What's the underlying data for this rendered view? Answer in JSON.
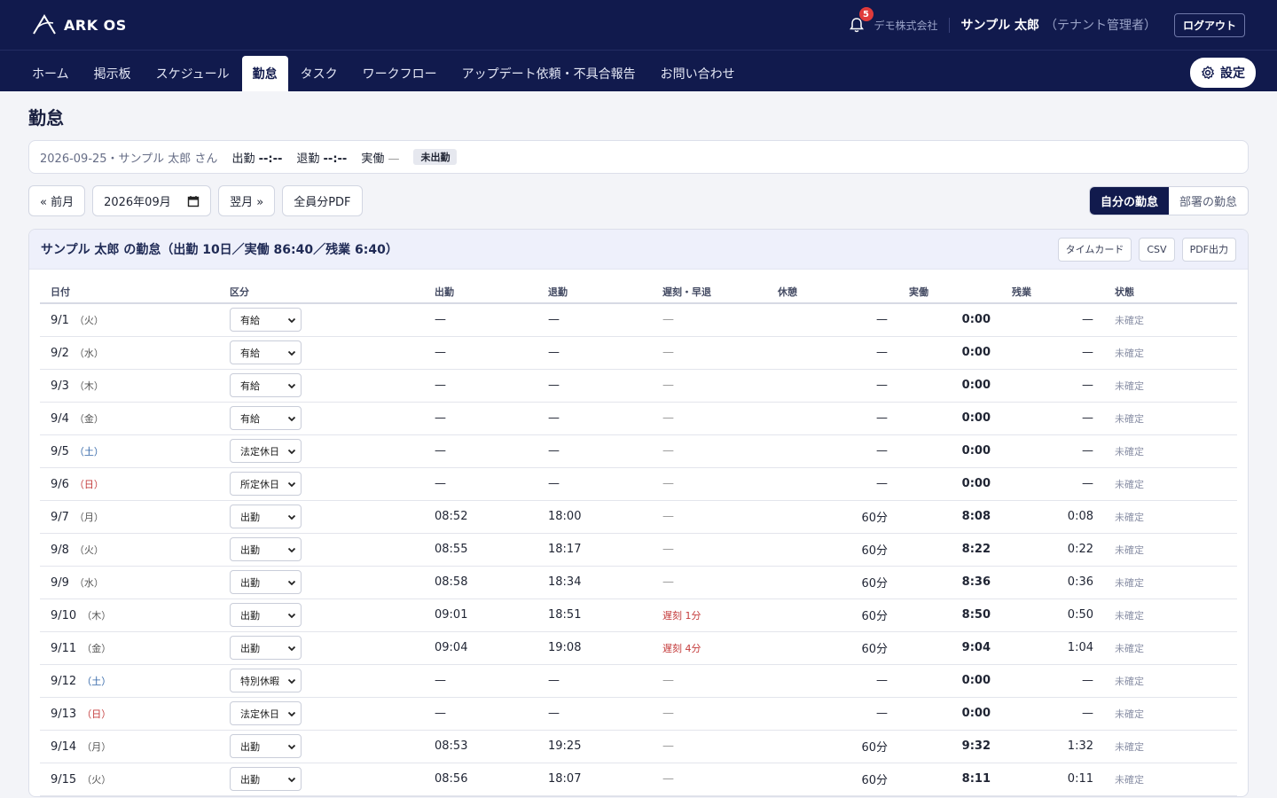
{
  "app": {
    "name": "ARK OS"
  },
  "header": {
    "notification_count": "5",
    "company": "デモ株式会社",
    "user_name": "サンプル 太郎",
    "user_role": "（テナント管理者）",
    "logout_label": "ログアウト"
  },
  "nav": {
    "items": [
      "ホーム",
      "掲示板",
      "スケジュール",
      "勤怠",
      "タスク",
      "ワークフロー",
      "アップデート依頼・不具合報告",
      "お問い合わせ"
    ],
    "active_index": 3,
    "settings_label": "設定"
  },
  "page": {
    "title": "勤怠"
  },
  "status": {
    "date_user": "2026-09-25・サンプル 太郎 さん",
    "clock_in_label": "出勤",
    "clock_in_value": "--:--",
    "clock_out_label": "退勤",
    "clock_out_value": "--:--",
    "actual_label": "実働",
    "actual_value": "—",
    "badge": "未出勤"
  },
  "controls": {
    "prev_label": "« 前月",
    "month_value": "2026年09月",
    "next_label": "翌月 »",
    "pdf_all_label": "全員分PDF",
    "view_mine": "自分の勤怠",
    "view_dept": "部署の勤怠"
  },
  "card": {
    "title": "サンプル 太郎 の勤怠（出勤 10日／実働 86:40／残業 6:40）",
    "timecard_label": "タイムカード",
    "csv_label": "CSV",
    "pdf_label": "PDF出力"
  },
  "table": {
    "headers": [
      "日付",
      "区分",
      "出勤",
      "退勤",
      "遅刻・早退",
      "休憩",
      "実働",
      "残業",
      "状態"
    ],
    "rows": [
      {
        "date": "9/1",
        "dow": "（火）",
        "dow_type": "weekday",
        "kubun": "有給",
        "in": "—",
        "out": "—",
        "late": "—",
        "rest": "—",
        "actual": "0:00",
        "overtime": "—",
        "state": "未確定"
      },
      {
        "date": "9/2",
        "dow": "（水）",
        "dow_type": "weekday",
        "kubun": "有給",
        "in": "—",
        "out": "—",
        "late": "—",
        "rest": "—",
        "actual": "0:00",
        "overtime": "—",
        "state": "未確定"
      },
      {
        "date": "9/3",
        "dow": "（木）",
        "dow_type": "weekday",
        "kubun": "有給",
        "in": "—",
        "out": "—",
        "late": "—",
        "rest": "—",
        "actual": "0:00",
        "overtime": "—",
        "state": "未確定"
      },
      {
        "date": "9/4",
        "dow": "（金）",
        "dow_type": "weekday",
        "kubun": "有給",
        "in": "—",
        "out": "—",
        "late": "—",
        "rest": "—",
        "actual": "0:00",
        "overtime": "—",
        "state": "未確定"
      },
      {
        "date": "9/5",
        "dow": "（土）",
        "dow_type": "sat",
        "kubun": "法定休日",
        "in": "—",
        "out": "—",
        "late": "—",
        "rest": "—",
        "actual": "0:00",
        "overtime": "—",
        "state": "未確定"
      },
      {
        "date": "9/6",
        "dow": "（日）",
        "dow_type": "sun",
        "kubun": "所定休日",
        "in": "—",
        "out": "—",
        "late": "—",
        "rest": "—",
        "actual": "0:00",
        "overtime": "—",
        "state": "未確定"
      },
      {
        "date": "9/7",
        "dow": "（月）",
        "dow_type": "weekday",
        "kubun": "出勤",
        "in": "08:52",
        "out": "18:00",
        "late": "—",
        "rest": "60分",
        "actual": "8:08",
        "overtime": "0:08",
        "state": "未確定"
      },
      {
        "date": "9/8",
        "dow": "（火）",
        "dow_type": "weekday",
        "kubun": "出勤",
        "in": "08:55",
        "out": "18:17",
        "late": "—",
        "rest": "60分",
        "actual": "8:22",
        "overtime": "0:22",
        "state": "未確定"
      },
      {
        "date": "9/9",
        "dow": "（水）",
        "dow_type": "weekday",
        "kubun": "出勤",
        "in": "08:58",
        "out": "18:34",
        "late": "—",
        "rest": "60分",
        "actual": "8:36",
        "overtime": "0:36",
        "state": "未確定"
      },
      {
        "date": "9/10",
        "dow": "（木）",
        "dow_type": "weekday",
        "kubun": "出勤",
        "in": "09:01",
        "out": "18:51",
        "late": "遅刻 1分",
        "rest": "60分",
        "actual": "8:50",
        "overtime": "0:50",
        "state": "未確定"
      },
      {
        "date": "9/11",
        "dow": "（金）",
        "dow_type": "weekday",
        "kubun": "出勤",
        "in": "09:04",
        "out": "19:08",
        "late": "遅刻 4分",
        "rest": "60分",
        "actual": "9:04",
        "overtime": "1:04",
        "state": "未確定"
      },
      {
        "date": "9/12",
        "dow": "（土）",
        "dow_type": "sat",
        "kubun": "特別休暇",
        "in": "—",
        "out": "—",
        "late": "—",
        "rest": "—",
        "actual": "0:00",
        "overtime": "—",
        "state": "未確定"
      },
      {
        "date": "9/13",
        "dow": "（日）",
        "dow_type": "sun",
        "kubun": "法定休日",
        "in": "—",
        "out": "—",
        "late": "—",
        "rest": "—",
        "actual": "0:00",
        "overtime": "—",
        "state": "未確定"
      },
      {
        "date": "9/14",
        "dow": "（月）",
        "dow_type": "weekday",
        "kubun": "出勤",
        "in": "08:53",
        "out": "19:25",
        "late": "—",
        "rest": "60分",
        "actual": "9:32",
        "overtime": "1:32",
        "state": "未確定"
      },
      {
        "date": "9/15",
        "dow": "（火）",
        "dow_type": "weekday",
        "kubun": "出勤",
        "in": "08:56",
        "out": "18:07",
        "late": "—",
        "rest": "60分",
        "actual": "8:11",
        "overtime": "0:11",
        "state": "未確定"
      }
    ]
  },
  "colors": {
    "navy": "#111a4d",
    "late_red": "#c43b3b",
    "sat_blue": "#3266a8",
    "badge_red": "#e03b3b"
  }
}
